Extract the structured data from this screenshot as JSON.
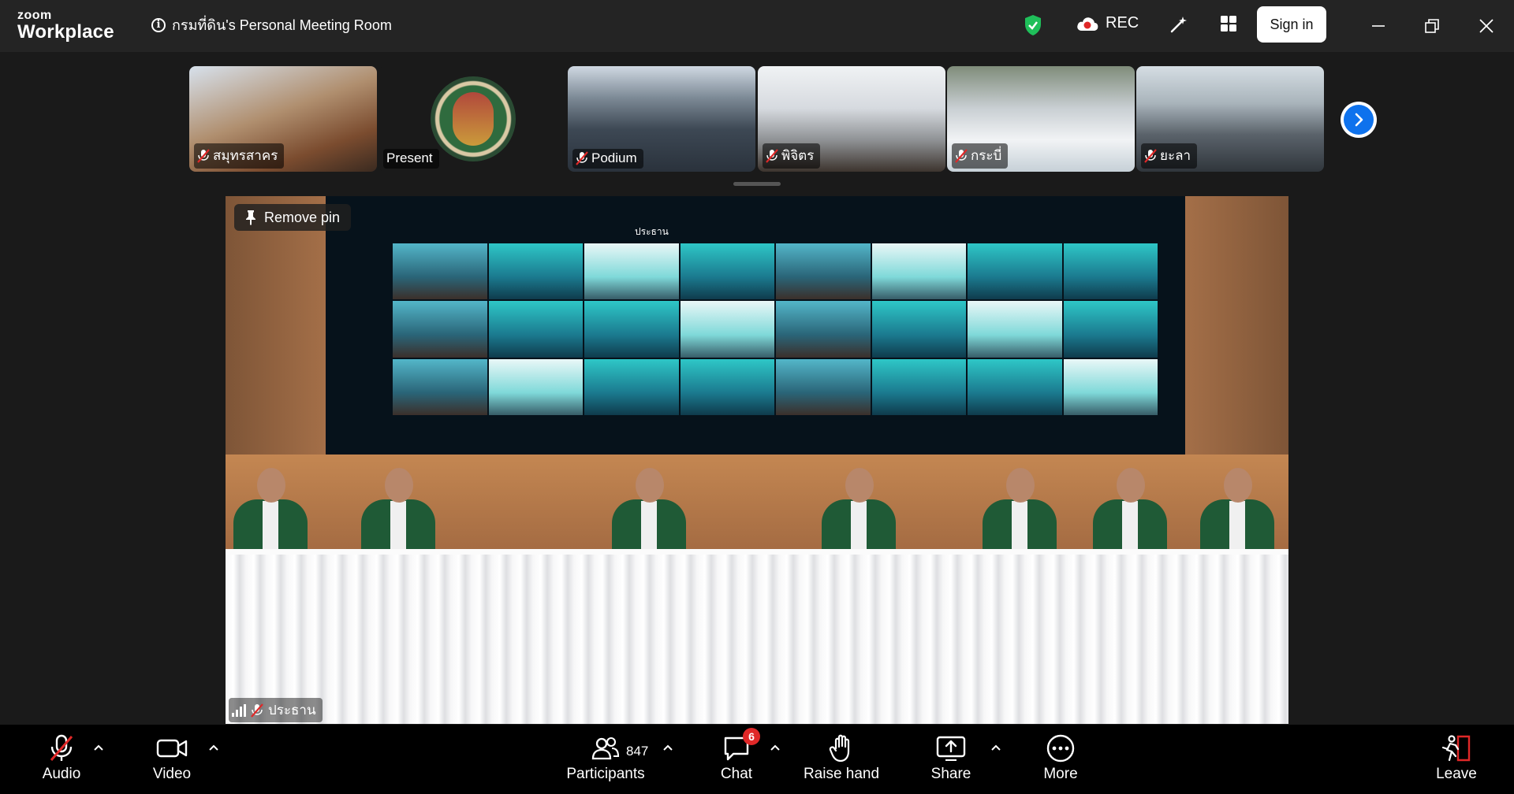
{
  "app": {
    "logo_top": "zoom",
    "logo_bottom": "Workplace",
    "meeting_title": "กรมที่ดิน's Personal Meeting Room",
    "rec_label": "REC",
    "signin_label": "Sign in"
  },
  "thumbnails": [
    {
      "name": "สมุทรสาคร",
      "muted": true
    },
    {
      "name": "Present",
      "muted": false
    },
    {
      "name": "Podium",
      "muted": true
    },
    {
      "name": "พิจิตร",
      "muted": true
    },
    {
      "name": "กระบี่",
      "muted": true
    },
    {
      "name": "ยะลา",
      "muted": true
    }
  ],
  "main_video": {
    "pin_label": "Remove pin",
    "speaker_name": "ประธาน",
    "screen_caption": "ประธาน"
  },
  "toolbar": {
    "audio": "Audio",
    "video": "Video",
    "participants": "Participants",
    "participants_count": "847",
    "chat": "Chat",
    "chat_badge": "6",
    "raise_hand": "Raise hand",
    "share": "Share",
    "more": "More",
    "leave": "Leave"
  },
  "colors": {
    "accent_blue": "#0e72ed",
    "muted_red": "#e02828",
    "shield_green": "#1fbf5a",
    "leave_red": "#e02828"
  }
}
